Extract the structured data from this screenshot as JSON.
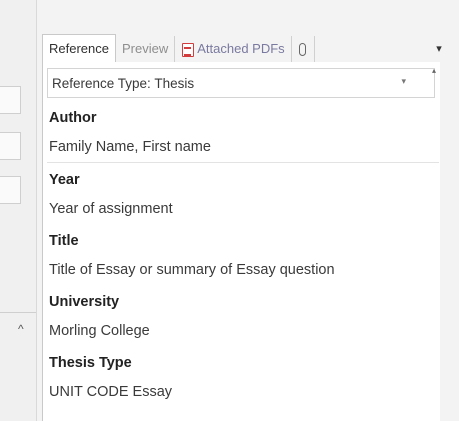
{
  "tabs": {
    "reference": "Reference",
    "preview": "Preview",
    "attached_pdfs": "Attached PDFs",
    "menu_arrow": "▾"
  },
  "reference_type": {
    "label": "Reference Type: Thesis"
  },
  "fields": [
    {
      "heading": "Author",
      "value": "Family Name, First name"
    },
    {
      "heading": "Year",
      "value": "Year of assignment"
    },
    {
      "heading": "Title",
      "value": "Title of Essay or summary of Essay question"
    },
    {
      "heading": "University",
      "value": "Morling College"
    },
    {
      "heading": "Thesis Type",
      "value": "UNIT CODE Essay"
    }
  ],
  "icons": {
    "pdf": "pdf-icon",
    "paperclip": "paperclip-icon",
    "collapse": "chevron-up-icon"
  },
  "colors": {
    "pdf_red": "#d23c3c",
    "heading_text": "#222222",
    "value_text": "#3a3a3a",
    "inactive_tab": "#8e8e8e"
  }
}
